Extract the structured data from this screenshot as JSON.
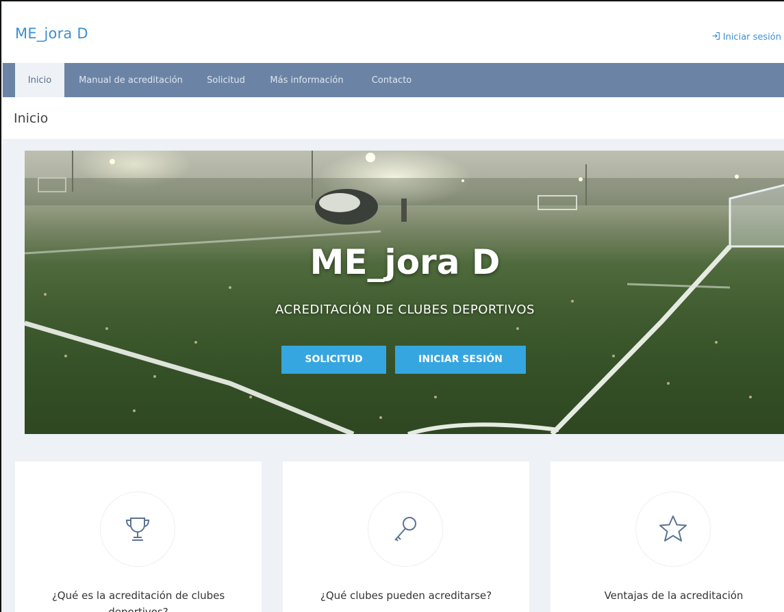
{
  "header": {
    "brand": "ME_jora D",
    "login_label": "Iniciar sesión"
  },
  "nav": {
    "items": [
      {
        "label": "Inicio",
        "active": true
      },
      {
        "label": "Manual de acreditación",
        "active": false
      },
      {
        "label": "Solicitud",
        "active": false
      },
      {
        "label": "Más información",
        "active": false
      },
      {
        "label": "Contacto",
        "active": false
      }
    ]
  },
  "page": {
    "title": "Inicio"
  },
  "hero": {
    "title": "ME_jora D",
    "subtitle": "ACREDITACIÓN DE CLUBES DEPORTIVOS",
    "btn_solicitud": "SOLICITUD",
    "btn_login": "INICIAR SESIÓN"
  },
  "cards": [
    {
      "icon": "trophy-icon",
      "title": "¿Qué es la acreditación de clubes deportivos?"
    },
    {
      "icon": "key-icon",
      "title": "¿Qué clubes pueden acreditarse?"
    },
    {
      "icon": "star-icon",
      "title": "Ventajas de la acreditación"
    }
  ],
  "colors": {
    "brand": "#3d8fd1",
    "navbar": "#6b84a6",
    "button": "#35a6e0",
    "background": "#eef1f5"
  }
}
